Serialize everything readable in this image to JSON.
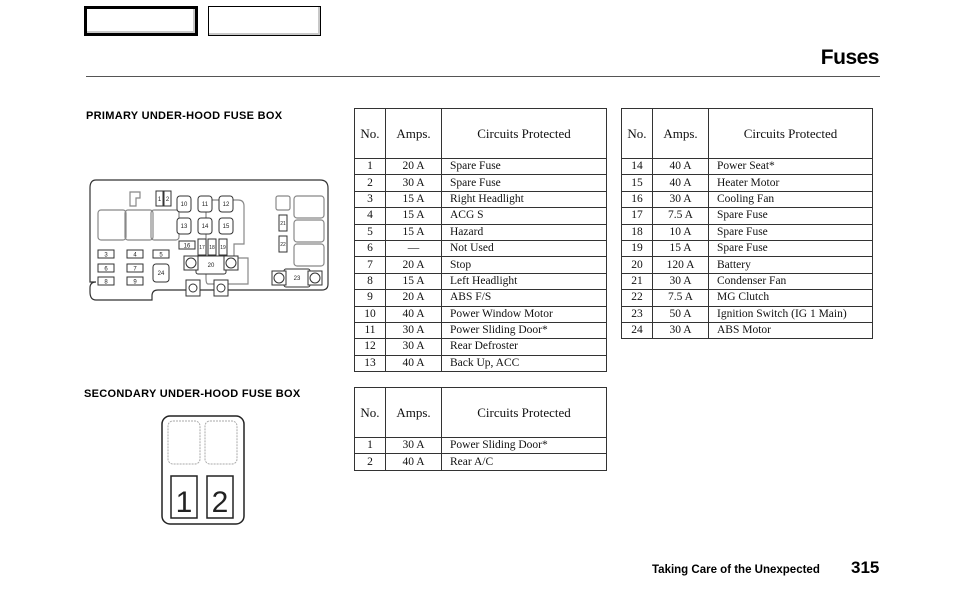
{
  "navigation": {
    "prev_button": "",
    "next_button": ""
  },
  "header": {
    "title": "Fuses"
  },
  "primary_box": {
    "label": "PRIMARY UNDER-HOOD FUSE BOX",
    "diagram_fuse_numbers": [
      "1",
      "2",
      "3",
      "4",
      "5",
      "6",
      "7",
      "8",
      "9",
      "10",
      "11",
      "12",
      "13",
      "14",
      "15",
      "16",
      "17",
      "18",
      "19",
      "20",
      "21",
      "22",
      "23",
      "24"
    ],
    "tables": [
      {
        "headers": {
          "no": "No.",
          "amps": "Amps.",
          "circuits": "Circuits Protected"
        },
        "rows": [
          {
            "no": "1",
            "amps": "20 A",
            "circuit": "Spare Fuse"
          },
          {
            "no": "2",
            "amps": "30 A",
            "circuit": "Spare Fuse"
          },
          {
            "no": "3",
            "amps": "15 A",
            "circuit": "Right Headlight"
          },
          {
            "no": "4",
            "amps": "15 A",
            "circuit": "ACG S"
          },
          {
            "no": "5",
            "amps": "15 A",
            "circuit": "Hazard"
          },
          {
            "no": "6",
            "amps": "—",
            "circuit": "Not Used"
          },
          {
            "no": "7",
            "amps": "20 A",
            "circuit": "Stop"
          },
          {
            "no": "8",
            "amps": "15 A",
            "circuit": "Left Headlight"
          },
          {
            "no": "9",
            "amps": "20 A",
            "circuit": "ABS F/S"
          },
          {
            "no": "10",
            "amps": "40 A",
            "circuit": "Power Window Motor"
          },
          {
            "no": "11",
            "amps": "30 A",
            "circuit": "Power Sliding Door*"
          },
          {
            "no": "12",
            "amps": "30 A",
            "circuit": "Rear Defroster"
          },
          {
            "no": "13",
            "amps": "40 A",
            "circuit": "Back Up, ACC"
          }
        ]
      },
      {
        "headers": {
          "no": "No.",
          "amps": "Amps.",
          "circuits": "Circuits Protected"
        },
        "rows": [
          {
            "no": "14",
            "amps": "40 A",
            "circuit": "Power Seat*"
          },
          {
            "no": "15",
            "amps": "40 A",
            "circuit": "Heater Motor"
          },
          {
            "no": "16",
            "amps": "30 A",
            "circuit": "Cooling Fan"
          },
          {
            "no": "17",
            "amps": "7.5 A",
            "circuit": "Spare Fuse"
          },
          {
            "no": "18",
            "amps": "10 A",
            "circuit": "Spare Fuse"
          },
          {
            "no": "19",
            "amps": "15 A",
            "circuit": "Spare Fuse"
          },
          {
            "no": "20",
            "amps": "120 A",
            "circuit": "Battery"
          },
          {
            "no": "21",
            "amps": "30 A",
            "circuit": "Condenser Fan"
          },
          {
            "no": "22",
            "amps": "7.5 A",
            "circuit": "MG Clutch"
          },
          {
            "no": "23",
            "amps": "50 A",
            "circuit": "Ignition Switch (IG 1 Main)"
          },
          {
            "no": "24",
            "amps": "30 A",
            "circuit": "ABS Motor"
          }
        ]
      }
    ]
  },
  "secondary_box": {
    "label": "SECONDARY UNDER-HOOD FUSE BOX",
    "diagram_fuse_numbers": [
      "1",
      "2"
    ],
    "table": {
      "headers": {
        "no": "No.",
        "amps": "Amps.",
        "circuits": "Circuits Protected"
      },
      "rows": [
        {
          "no": "1",
          "amps": "30 A",
          "circuit": "Power Sliding Door*"
        },
        {
          "no": "2",
          "amps": "40 A",
          "circuit": "Rear A/C"
        }
      ]
    }
  },
  "footer": {
    "section": "Taking Care of the Unexpected",
    "page_number": "315"
  }
}
